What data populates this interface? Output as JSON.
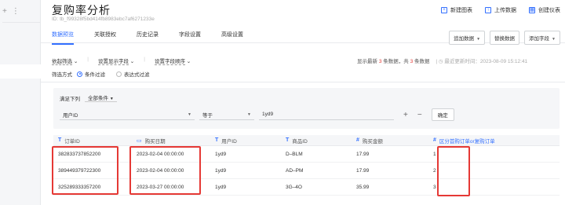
{
  "sidebar": {
    "add_icon": "+",
    "more_icon": "⋮"
  },
  "header": {
    "title": "复购率分析",
    "id_text": "ID: tb_f99328f5bd414fb8983ebc7af6271233e",
    "actions": [
      {
        "label": "新建图表",
        "icon": "chart-plus-icon"
      },
      {
        "label": "上传数据",
        "icon": "upload-icon"
      },
      {
        "label": "创建仪表",
        "icon": "dashboard-icon"
      }
    ]
  },
  "tabs": [
    "数据预览",
    "关联授权",
    "历史记录",
    "字段设置",
    "高级设置"
  ],
  "tab_buttons": {
    "add_data": "追加数据",
    "replace_data": "替换数据",
    "add_field": "添加字段"
  },
  "filter_bar": {
    "items": [
      "依起筛选",
      "设置显示字段",
      "设置字段顺序"
    ],
    "stats_prefix": "显示最新",
    "stats_n1": "3",
    "stats_mid": "条数据，共",
    "stats_n2": "3",
    "stats_suffix": "条数据",
    "updated": "最近更新时间：2023-08-09 15:12:41"
  },
  "filter_mode": {
    "label": "筛选方式",
    "option1": "条件过滤",
    "option2": "表达式过滤"
  },
  "condition": {
    "satisfy": "满足下列",
    "all_conditions": "全部条件",
    "field": "用户ID",
    "operator": "等于",
    "value": "1yd9",
    "plus": "+",
    "minus": "−",
    "confirm": "确定"
  },
  "table": {
    "headers": [
      {
        "type": "T",
        "label": "订单ID"
      },
      {
        "type": "▭",
        "label": "购买日期"
      },
      {
        "type": "T",
        "label": "用户ID"
      },
      {
        "type": "T",
        "label": "商品ID"
      },
      {
        "type": "#",
        "label": "购买金额"
      },
      {
        "type": "#",
        "label": "区分首购订单or复购订单"
      }
    ],
    "rows": [
      [
        "382833737852200",
        "2023-02-04 00:00:00",
        "1yd9",
        "D–BLM",
        "17.99",
        "1"
      ],
      [
        "389449379722300",
        "2023-02-04 00:00:00",
        "1yd9",
        "AD–PM",
        "17.99",
        "2"
      ],
      [
        "325289333357200",
        "2023-03-27 00:00:00",
        "1yd9",
        "3G–4O",
        "35.99",
        "3"
      ]
    ]
  },
  "colors": {
    "accent": "#3370ff",
    "highlight": "#e53935"
  }
}
